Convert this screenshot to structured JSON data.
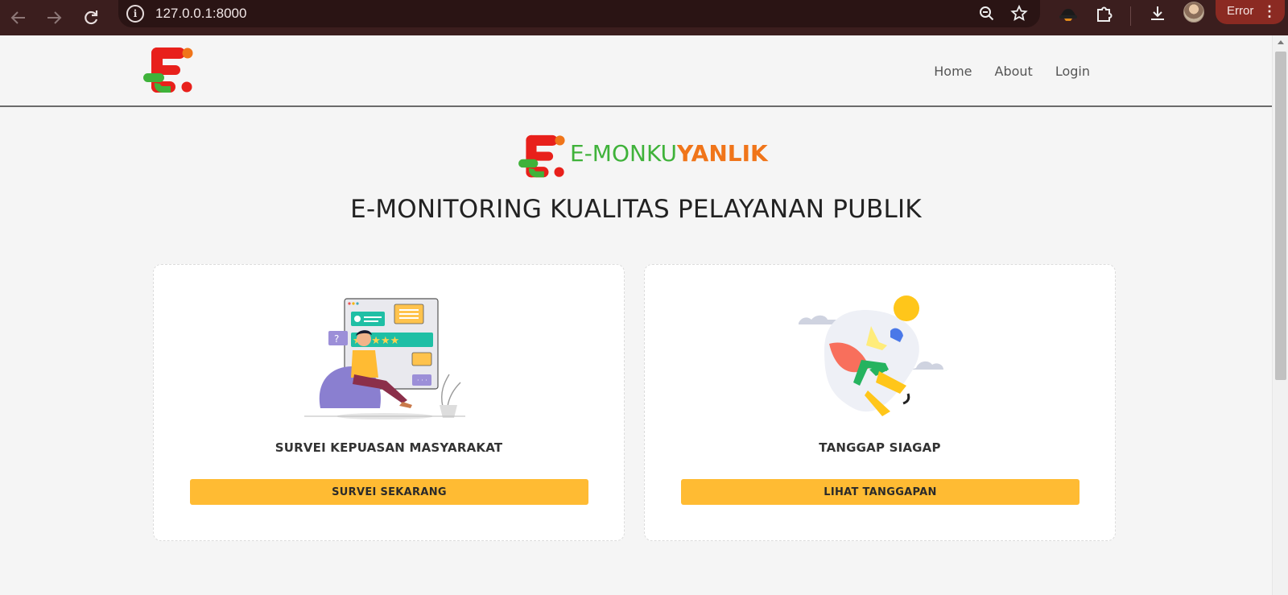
{
  "browser": {
    "url": "127.0.0.1:8000",
    "error_label": "Error",
    "icons": [
      "back-icon",
      "forward-icon",
      "reload-icon",
      "info-icon",
      "zoom-out-icon",
      "star-icon",
      "extension-hat-icon",
      "puzzle-icon",
      "download-icon",
      "profile-avatar",
      "kebab-menu-icon"
    ]
  },
  "nav": {
    "links": [
      "Home",
      "About",
      "Login"
    ]
  },
  "hero": {
    "brand_part1": "E-MONKU",
    "brand_part2": "YANLIK",
    "title": "E-MONITORING KUALITAS PELAYANAN PUBLIK"
  },
  "cards": [
    {
      "title": "SURVEI KEPUASAN MASYARAKAT",
      "button": "SURVEI SEKARANG",
      "illustration": "survey-illustration"
    },
    {
      "title": "TANGGAP SIAGAP",
      "button": "LIHAT TANGGAPAN",
      "illustration": "rocket-illustration"
    }
  ],
  "colors": {
    "brand_red": "#e8201b",
    "brand_green": "#3fb23a",
    "brand_orange": "#f0751a",
    "button_yellow": "#ffbb33",
    "chrome_dark": "#3b1e1e"
  }
}
